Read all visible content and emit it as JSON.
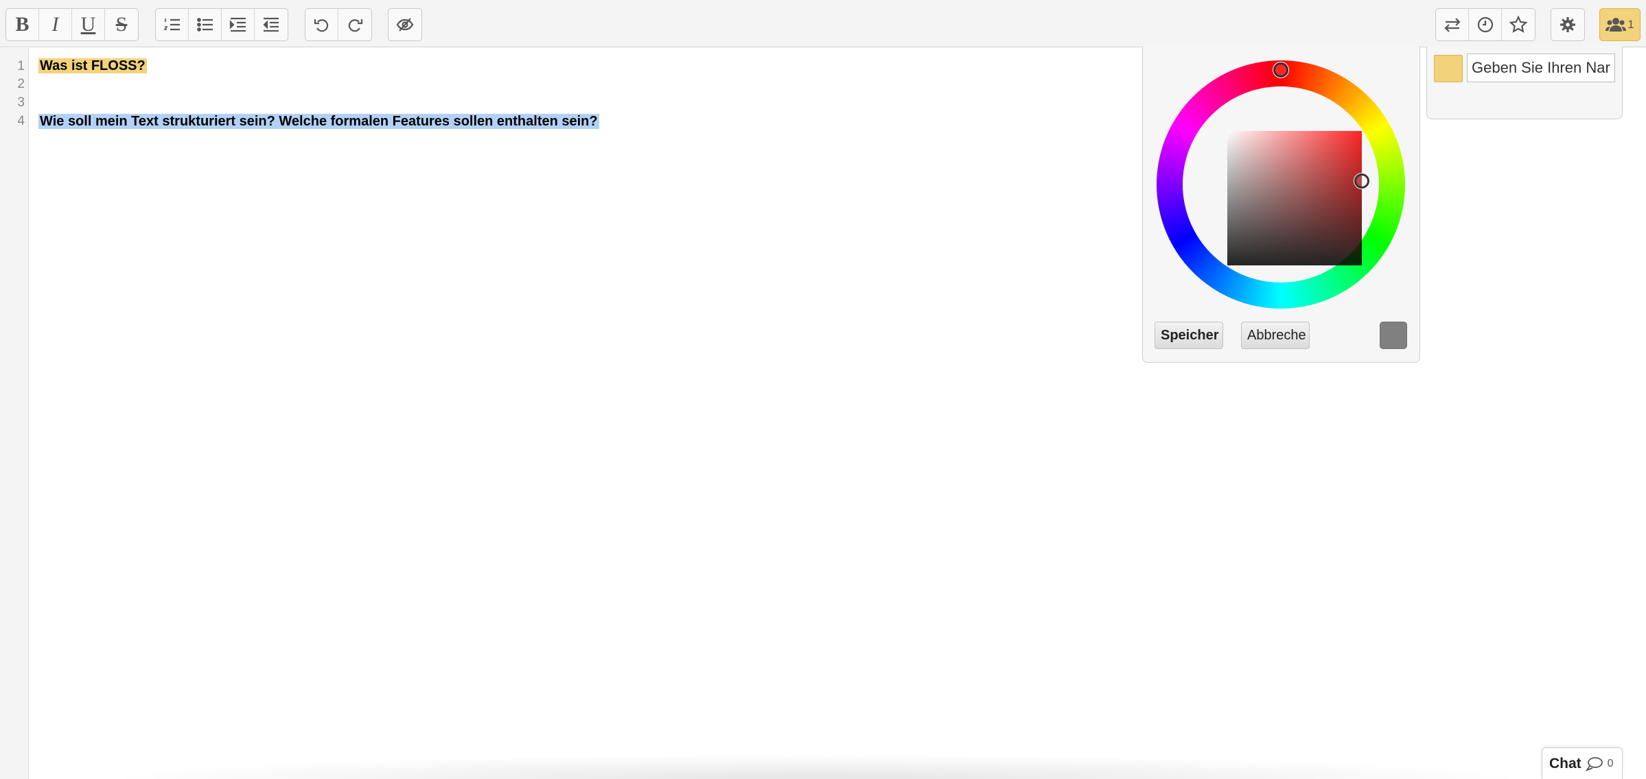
{
  "toolbar": {
    "format_buttons": [
      {
        "name": "bold",
        "glyph": "B"
      },
      {
        "name": "italic",
        "glyph": "I"
      },
      {
        "name": "underline",
        "glyph": "U"
      },
      {
        "name": "strikethrough",
        "glyph": "S"
      }
    ],
    "list_buttons": [
      "ordered-list-icon",
      "unordered-list-icon",
      "indent-icon",
      "outdent-icon"
    ],
    "history_buttons": [
      "undo-icon",
      "redo-icon"
    ],
    "visibility_button": "eye-slash-icon",
    "right_buttons": [
      "import-export-icon",
      "timeslider-icon",
      "star-icon"
    ],
    "settings_button": "gear-icon",
    "users": {
      "icon": "users-icon",
      "count": "1",
      "color": "#f2d27a"
    }
  },
  "editor": {
    "lines": [
      {
        "number": "1",
        "text": "Was ist FLOSS?",
        "highlight": "#f2d27a"
      },
      {
        "number": "2",
        "text": "",
        "highlight": ""
      },
      {
        "number": "3",
        "text": "",
        "highlight": ""
      },
      {
        "number": "4",
        "text": "Wie soll mein Text strukturiert sein? Welche formalen Features sollen enthalten sein?",
        "highlight": "#b3d1f5"
      }
    ]
  },
  "color_picker": {
    "save_label": "Speicher",
    "cancel_label": "Abbreche",
    "preview_color": "#808080"
  },
  "user_panel": {
    "swatch_color": "#f2d27a",
    "name_placeholder": "Geben Sie Ihren Nar"
  },
  "chat": {
    "label": "Chat",
    "count": "0"
  }
}
